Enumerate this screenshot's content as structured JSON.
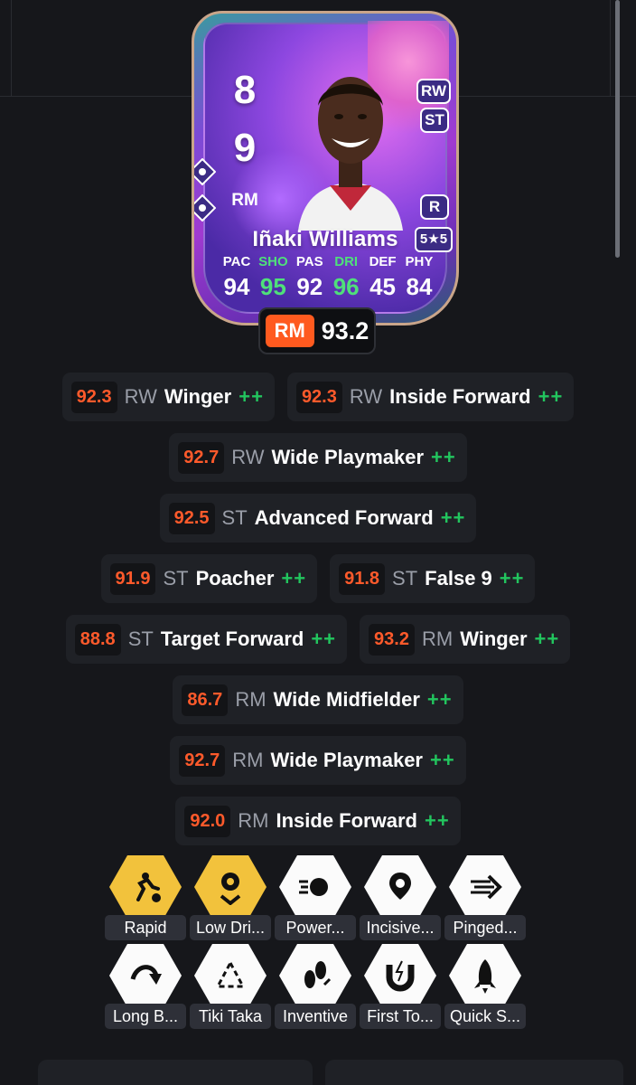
{
  "card": {
    "rating_digit_1": "8",
    "rating_digit_2": "9",
    "position": "RM",
    "alt_positions": [
      "RW",
      "ST"
    ],
    "foot": "R",
    "skill_weak": "5★5",
    "name": "Iñaki Williams",
    "stats": [
      {
        "label": "PAC",
        "value": "94",
        "highlight": false
      },
      {
        "label": "SHO",
        "value": "95",
        "highlight": true
      },
      {
        "label": "PAS",
        "value": "92",
        "highlight": false
      },
      {
        "label": "DRI",
        "value": "96",
        "highlight": true
      },
      {
        "label": "DEF",
        "value": "45",
        "highlight": false
      },
      {
        "label": "PHY",
        "value": "84",
        "highlight": false
      }
    ]
  },
  "best_rating": {
    "position": "RM",
    "value": "93.2"
  },
  "roles": [
    [
      {
        "rating": "92.3",
        "pos": "RW",
        "name": "Winger",
        "plus": "++"
      },
      {
        "rating": "92.3",
        "pos": "RW",
        "name": "Inside Forward",
        "plus": "++"
      }
    ],
    [
      {
        "rating": "92.7",
        "pos": "RW",
        "name": "Wide Playmaker",
        "plus": "++"
      }
    ],
    [
      {
        "rating": "92.5",
        "pos": "ST",
        "name": "Advanced Forward",
        "plus": "++"
      }
    ],
    [
      {
        "rating": "91.9",
        "pos": "ST",
        "name": "Poacher",
        "plus": "++"
      },
      {
        "rating": "91.8",
        "pos": "ST",
        "name": "False 9",
        "plus": "++"
      }
    ],
    [
      {
        "rating": "88.8",
        "pos": "ST",
        "name": "Target Forward",
        "plus": "++"
      },
      {
        "rating": "93.2",
        "pos": "RM",
        "name": "Winger",
        "plus": "++"
      }
    ],
    [
      {
        "rating": "86.7",
        "pos": "RM",
        "name": "Wide Midfielder",
        "plus": "++"
      }
    ],
    [
      {
        "rating": "92.7",
        "pos": "RM",
        "name": "Wide Playmaker",
        "plus": "++"
      }
    ],
    [
      {
        "rating": "92.0",
        "pos": "RM",
        "name": "Inside Forward",
        "plus": "++"
      }
    ]
  ],
  "playstyles": [
    [
      {
        "label": "Rapid",
        "tier": "gold",
        "icon": "rapid-icon"
      },
      {
        "label": "Low Dri...",
        "tier": "gold",
        "icon": "low-driven-shot-icon"
      },
      {
        "label": "Power...",
        "tier": "white",
        "icon": "power-shot-icon"
      },
      {
        "label": "Incisive...",
        "tier": "white",
        "icon": "incisive-pass-icon"
      },
      {
        "label": "Pinged...",
        "tier": "white",
        "icon": "pinged-pass-icon"
      }
    ],
    [
      {
        "label": "Long B...",
        "tier": "white",
        "icon": "long-ball-pass-icon"
      },
      {
        "label": "Tiki Taka",
        "tier": "white",
        "icon": "tiki-taka-icon"
      },
      {
        "label": "Inventive",
        "tier": "white",
        "icon": "inventive-icon"
      },
      {
        "label": "First To...",
        "tier": "white",
        "icon": "first-touch-icon"
      },
      {
        "label": "Quick S...",
        "tier": "white",
        "icon": "quick-step-icon"
      }
    ]
  ],
  "colors": {
    "background": "#16171b",
    "accent_orange": "#ff5a2b",
    "plus_green": "#22c55e",
    "gold": "#f2c23c"
  }
}
